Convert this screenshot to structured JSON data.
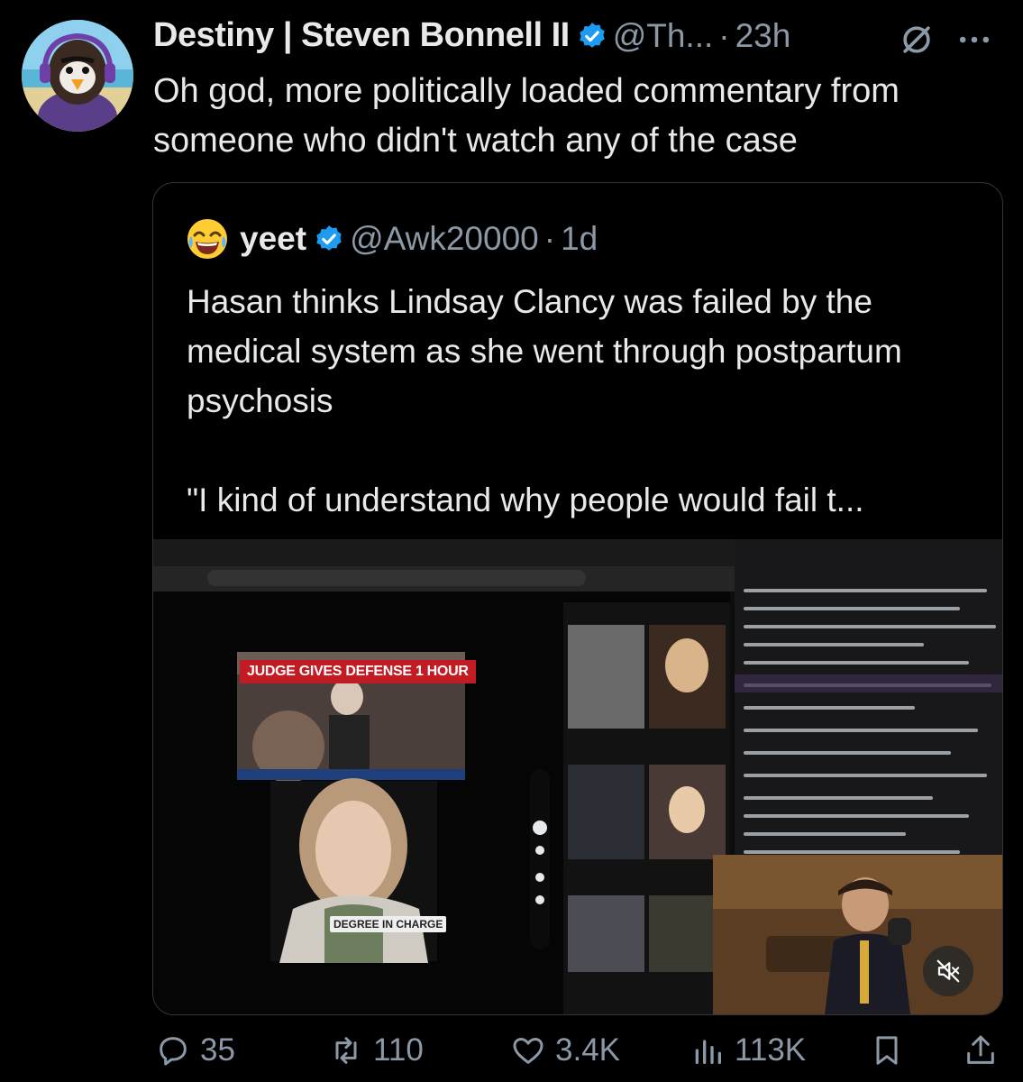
{
  "tweet": {
    "author_name": "Destiny | Steven Bonnell II",
    "handle": "@Th...",
    "separator": "·",
    "time": "23h",
    "text": "Oh god, more politically loaded commentary from someone who didn't watch any of the case"
  },
  "quoted_tweet": {
    "author_name": "yeet",
    "handle": "@Awk20000",
    "separator": "·",
    "time": "1d",
    "text": "Hasan thinks Lindsay Clancy was failed by the medical system as she went through postpartum psychosis\n\n\"I kind of understand why people would fail t...",
    "media": {
      "news_banner": "JUDGE GIVES DEFENSE 1 HOUR",
      "caption": "DEGREE IN CHARGE"
    }
  },
  "actions": {
    "replies": "35",
    "reposts": "110",
    "likes": "3.4K",
    "views": "113K"
  },
  "icons": {
    "verified": "verified-badge-icon",
    "grok": "grok-icon",
    "more": "more-icon",
    "reply": "reply-icon",
    "repost": "repost-icon",
    "like": "like-icon",
    "views": "views-icon",
    "bookmark": "bookmark-icon",
    "share": "share-icon",
    "mute": "muted-speaker-icon"
  },
  "colors": {
    "background": "#000000",
    "text": "#e7e9ea",
    "secondary": "#8b98a5",
    "verified_blue": "#1d9bf0"
  }
}
